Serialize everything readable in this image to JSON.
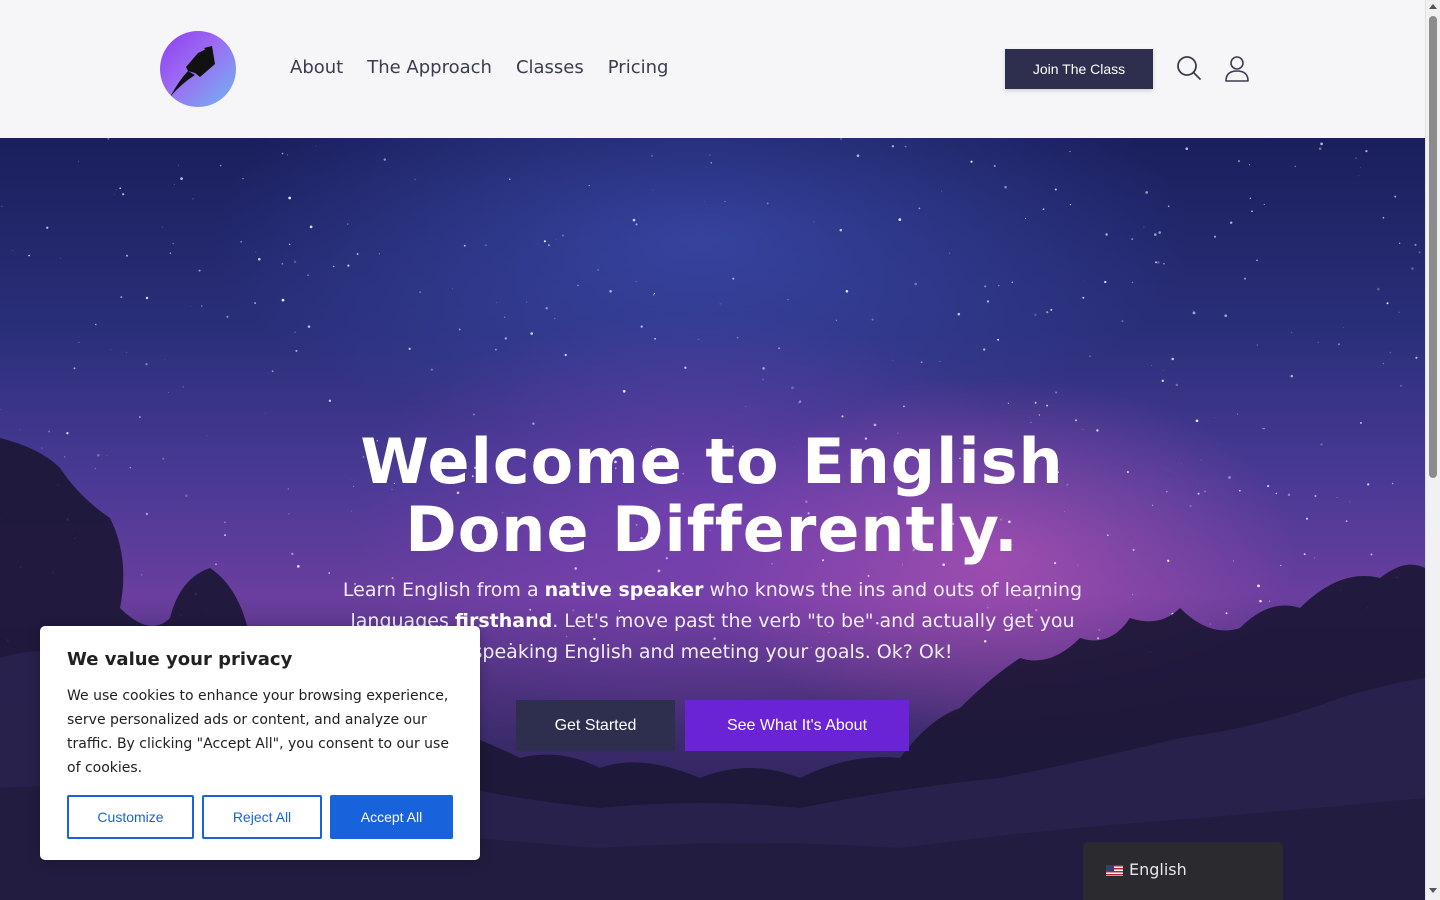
{
  "header": {
    "nav": [
      "About",
      "The Approach",
      "Classes",
      "Pricing"
    ],
    "join_label": "Join The Class",
    "icons": {
      "search": "search-icon",
      "user": "user-icon",
      "logo": "rocket-logo-icon"
    }
  },
  "hero": {
    "title_line1": "Welcome to English",
    "title_line2": "Done Differently.",
    "sub_part1": "Learn English from a ",
    "sub_bold1": "native speaker",
    "sub_part2": " who knows the ins and outs of learning languages ",
    "sub_bold2": "firsthand",
    "sub_part3": ". Let's move past the verb \"to be\" and actually get you speaking English and meeting your goals. Ok? Ok!",
    "btn_started": "Get Started",
    "btn_about": "See What It's About"
  },
  "cookie": {
    "title": "We value your privacy",
    "text": "We use cookies to enhance your browsing experience, serve personalized ads or content, and analyze our traffic. By clicking \"Accept All\", you consent to our use of cookies.",
    "customize": "Customize",
    "reject": "Reject All",
    "accept": "Accept All"
  },
  "language": {
    "label": "English",
    "flag": "us-flag-icon"
  },
  "colors": {
    "primary_dark": "#2e2f4f",
    "purple": "#6b23d6",
    "cookie_blue": "#1863dc"
  }
}
